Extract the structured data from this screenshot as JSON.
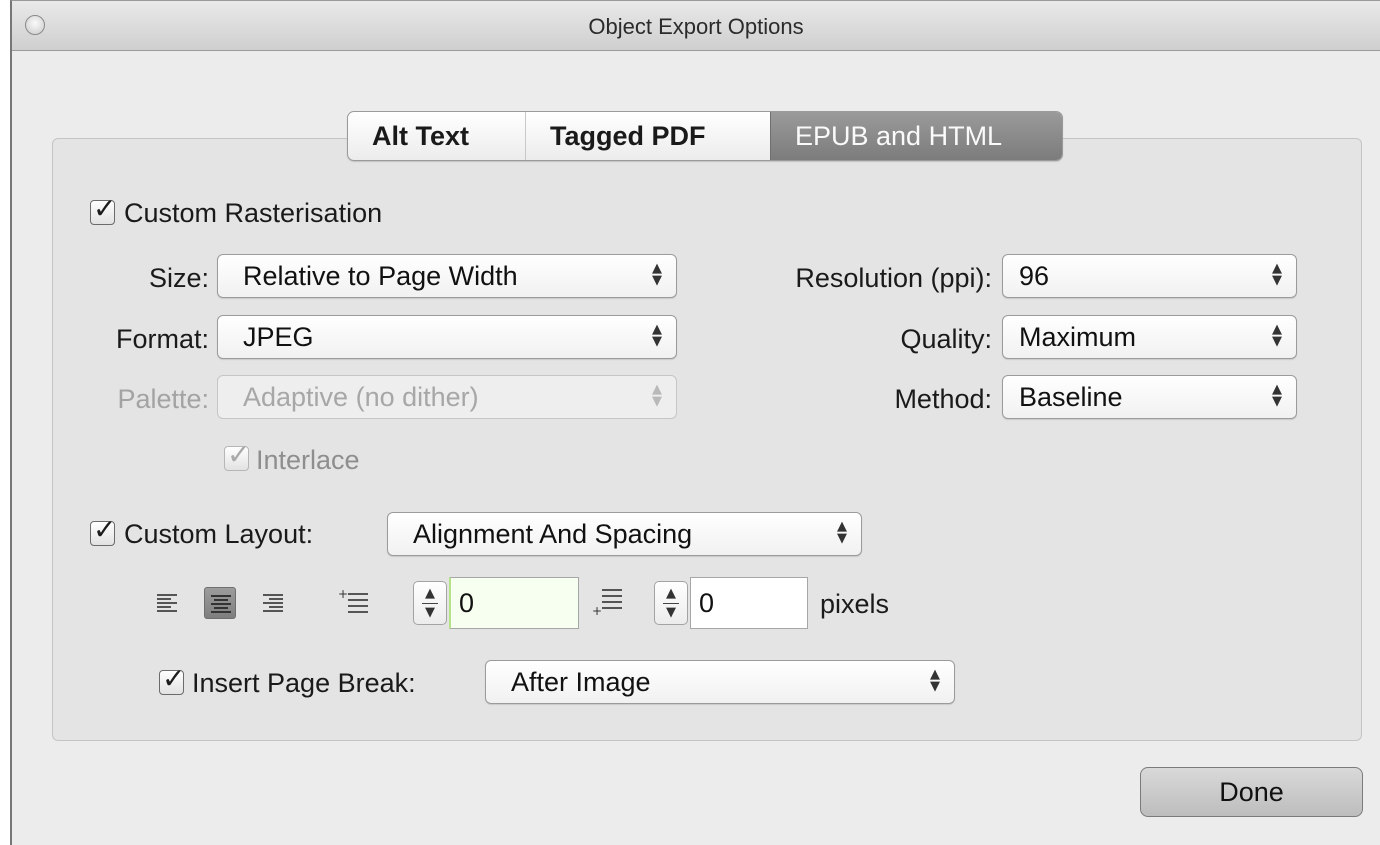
{
  "window": {
    "title": "Object Export Options"
  },
  "tabs": [
    {
      "label": "Alt Text",
      "active": false
    },
    {
      "label": "Tagged PDF",
      "active": false
    },
    {
      "label": "EPUB and HTML",
      "active": true
    }
  ],
  "rasterisation": {
    "checkbox_label": "Custom Rasterisation",
    "checked": true,
    "size": {
      "label": "Size:",
      "value": "Relative to Page Width"
    },
    "format": {
      "label": "Format:",
      "value": "JPEG"
    },
    "palette": {
      "label": "Palette:",
      "value": "Adaptive (no dither)",
      "enabled": false
    },
    "interlace": {
      "label": "Interlace",
      "checked": true,
      "enabled": false
    },
    "resolution": {
      "label": "Resolution (ppi):",
      "value": "96"
    },
    "quality": {
      "label": "Quality:",
      "value": "Maximum"
    },
    "method": {
      "label": "Method:",
      "value": "Baseline"
    }
  },
  "layout": {
    "checkbox_label": "Custom Layout:",
    "checked": true,
    "value": "Alignment And Spacing",
    "alignment_selected": "center",
    "space_before": "0",
    "space_after": "0",
    "units": "pixels"
  },
  "page_break": {
    "checkbox_label": "Insert Page Break:",
    "checked": true,
    "value": "After Image"
  },
  "buttons": {
    "done": "Done"
  },
  "icons": {
    "close": "close-icon",
    "check": "checkmark-icon",
    "select_arrows": "up-down-arrows-icon",
    "align_left": "align-left-icon",
    "align_center": "align-center-icon",
    "align_right": "align-right-icon",
    "space_before": "space-before-icon",
    "space_after": "space-after-icon"
  },
  "colors": {
    "active_tab": "#8a8a8a",
    "focus_field": "#f7fff0"
  }
}
